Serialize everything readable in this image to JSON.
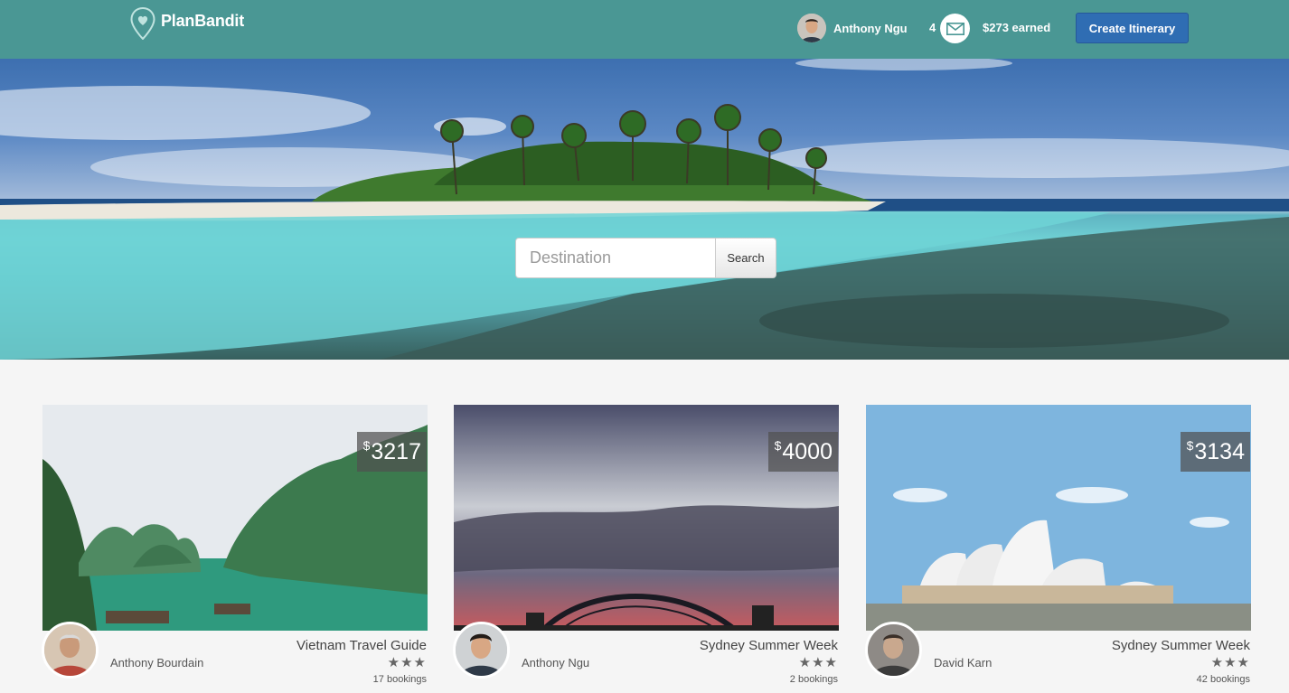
{
  "header": {
    "logo_text": "PlanBandit",
    "user_name": "Anthony Ngu",
    "message_count": "4",
    "earned": "$273 earned",
    "create_button": "Create Itinerary"
  },
  "hero": {
    "search_placeholder": "Destination",
    "search_button": "Search"
  },
  "cards": [
    {
      "price_symbol": "$",
      "price": "3217",
      "title": "Vietnam Travel Guide",
      "author": "Anthony Bourdain",
      "stars": "★★★",
      "bookings": "17 bookings"
    },
    {
      "price_symbol": "$",
      "price": "4000",
      "title": "Sydney Summer Week",
      "author": "Anthony Ngu",
      "stars": "★★★",
      "bookings": "2 bookings"
    },
    {
      "price_symbol": "$",
      "price": "3134",
      "title": "Sydney Summer Week",
      "author": "David Karn",
      "stars": "★★★",
      "bookings": "42 bookings"
    }
  ],
  "colors": {
    "header": "#4a9794",
    "create_button": "#2f6db3"
  },
  "icons": {
    "logo": "map-pin-heart-icon",
    "mail": "envelope-icon"
  }
}
